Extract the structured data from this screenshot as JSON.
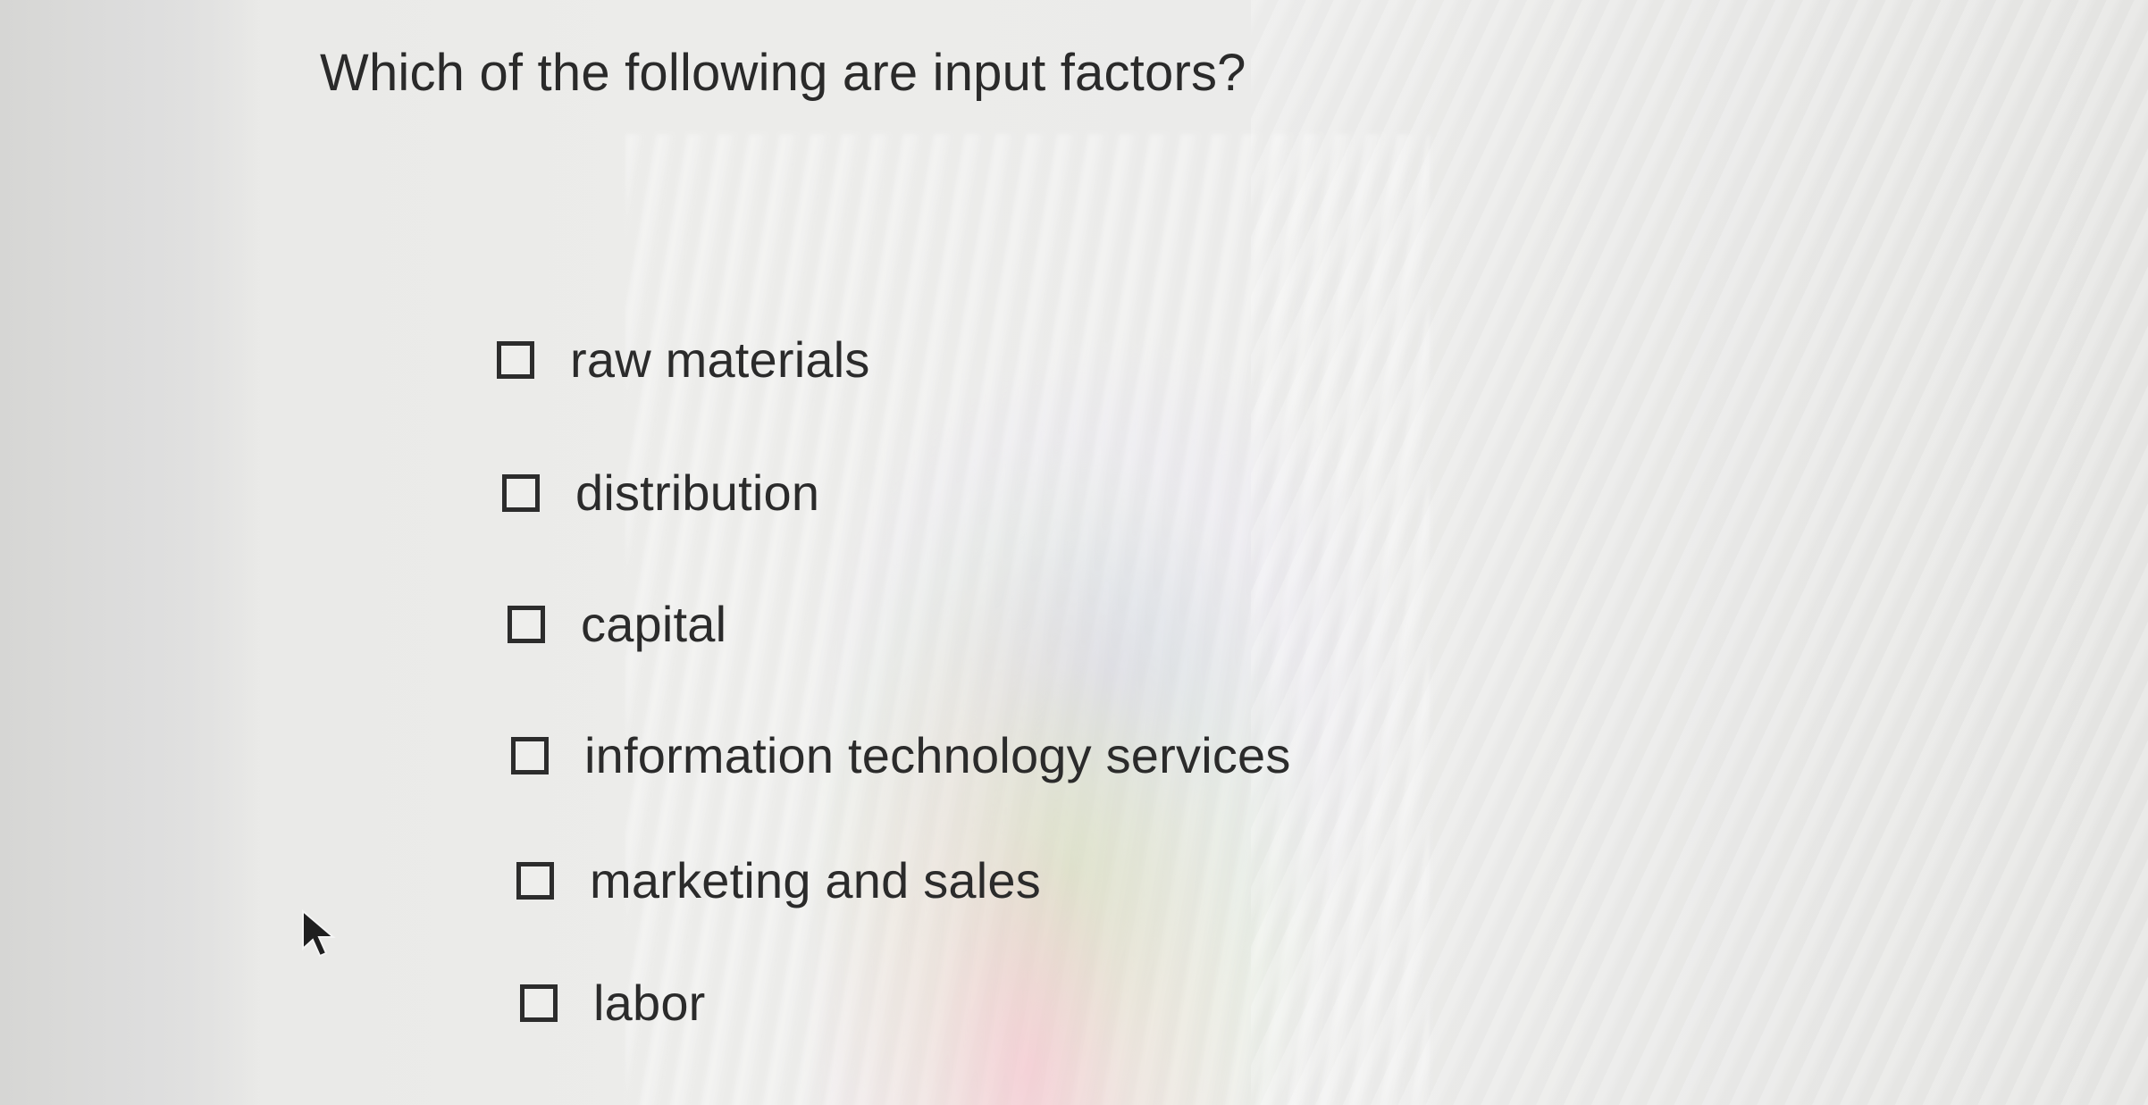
{
  "question": {
    "text": "Which of the following are input factors?"
  },
  "options": [
    {
      "label": "raw materials",
      "checked": false
    },
    {
      "label": "distribution",
      "checked": false
    },
    {
      "label": "capital",
      "checked": false
    },
    {
      "label": "information technology services",
      "checked": false
    },
    {
      "label": "marketing and sales",
      "checked": false
    },
    {
      "label": "labor",
      "checked": false
    }
  ],
  "icons": {
    "cursor": "mouse-pointer-icon",
    "checkbox": "empty-checkbox-icon"
  },
  "colors": {
    "text": "#2b2b2b",
    "background": "#e9e9e7"
  }
}
